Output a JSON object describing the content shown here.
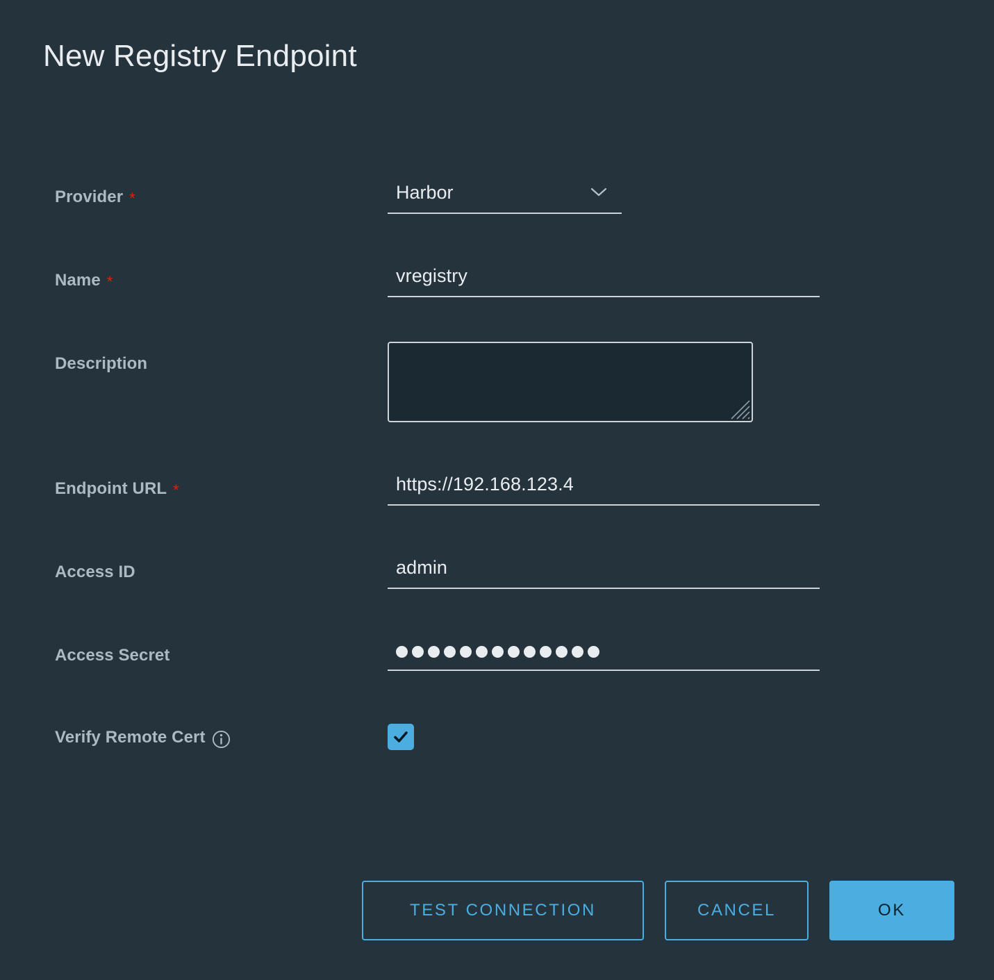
{
  "dialog": {
    "title": "New Registry Endpoint"
  },
  "colors": {
    "background": "#25333d",
    "accent": "#4caee0",
    "label": "#acbac3",
    "value": "#eaedf0",
    "required_star": "#e02200",
    "underline": "#cbd4d8",
    "textarea_bg": "#1b2a32"
  },
  "form": {
    "provider": {
      "label": "Provider",
      "required": true,
      "required_marker": "*",
      "value": "Harbor",
      "icon": "chevron-down-icon"
    },
    "name": {
      "label": "Name",
      "required": true,
      "required_marker": "*",
      "value": "vregistry",
      "placeholder": ""
    },
    "description": {
      "label": "Description",
      "required": false,
      "value": "",
      "placeholder": ""
    },
    "endpoint_url": {
      "label": "Endpoint URL",
      "required": true,
      "required_marker": "*",
      "value": "https://192.168.123.4",
      "placeholder": ""
    },
    "access_id": {
      "label": "Access ID",
      "required": false,
      "value": "admin",
      "placeholder": ""
    },
    "access_secret": {
      "label": "Access Secret",
      "required": false,
      "masked": true,
      "mask_char": "●",
      "mask_length": 13,
      "placeholder": ""
    },
    "verify_remote_cert": {
      "label": "Verify Remote Cert",
      "required": false,
      "info_icon": "info-circle-icon",
      "checked": true
    }
  },
  "footer": {
    "test_connection_label": "Test Connection",
    "cancel_label": "Cancel",
    "ok_label": "OK"
  }
}
